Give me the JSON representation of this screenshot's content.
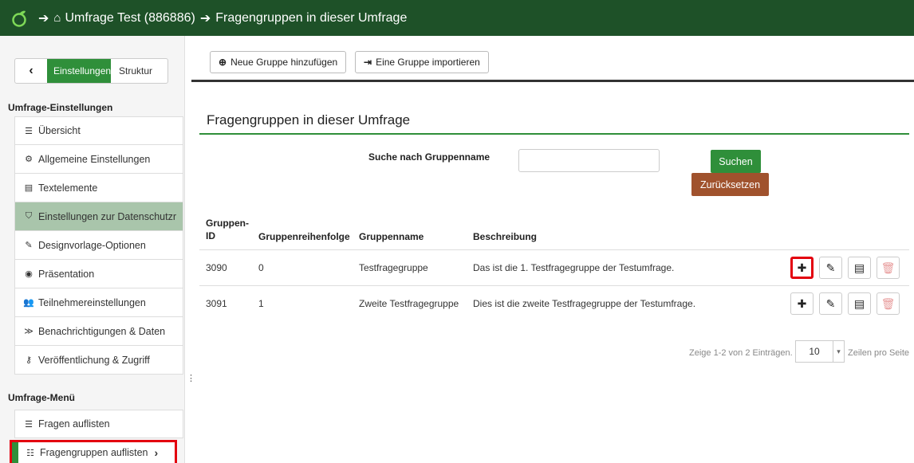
{
  "topbar": {
    "survey_title": "Umfrage Test (886886)",
    "page": "Fragengruppen in dieser Umfrage",
    "bg_color": "#1e5128"
  },
  "sidebar": {
    "back_label": "‹",
    "tabs": [
      "Einstellungen",
      "Struktur"
    ],
    "settings_title": "Umfrage-Einstellungen",
    "settings_items": [
      {
        "icon": "list-icon",
        "label": "Übersicht"
      },
      {
        "icon": "gears-icon",
        "label": "Allgemeine Einstellungen"
      },
      {
        "icon": "file-text-icon",
        "label": "Textelemente"
      },
      {
        "icon": "shield-icon",
        "label": "Einstellungen zur Datenschutzr"
      },
      {
        "icon": "brush-icon",
        "label": "Designvorlage-Optionen"
      },
      {
        "icon": "eye-slash-icon",
        "label": "Präsentation"
      },
      {
        "icon": "users-icon",
        "label": "Teilnehmereinstellungen"
      },
      {
        "icon": "rss-icon",
        "label": "Benachrichtigungen & Daten"
      },
      {
        "icon": "key-icon",
        "label": "Veröffentlichung & Zugriff"
      }
    ],
    "menu_title": "Umfrage-Menü",
    "menu_items": [
      {
        "icon": "list-icon",
        "label": "Fragen auflisten"
      },
      {
        "icon": "list-ol-icon",
        "label": "Fragengruppen auflisten"
      }
    ]
  },
  "toolbar": {
    "add_group": "Neue Gruppe hinzufügen",
    "import_group": "Eine Gruppe importieren"
  },
  "main": {
    "title": "Fragengruppen in dieser Umfrage",
    "search_label": "Suche nach Gruppenname",
    "search_value": "",
    "search_button": "Suchen",
    "reset_button": "Zurücksetzen",
    "accent_color": "#2f8f3a",
    "reset_color": "#a0522d"
  },
  "table": {
    "headers": {
      "id_line1": "Gruppen-",
      "id_line2": "ID",
      "order": "Gruppenreihenfolge",
      "name": "Gruppenname",
      "desc": "Beschreibung"
    },
    "rows": [
      {
        "id": "3090",
        "order": "0",
        "name": "Testfragegruppe",
        "desc": "Das ist die 1. Testfragegruppe der Testumfrage."
      },
      {
        "id": "3091",
        "order": "1",
        "name": "Zweite Testfragegruppe",
        "desc": "Dies ist die zweite Testfragegruppe der Testumfrage."
      }
    ]
  },
  "pager": {
    "summary": "Zeige 1-2 von 2 Einträgen.",
    "page_size": "10",
    "per_page_label": "Zeilen pro Seite"
  }
}
